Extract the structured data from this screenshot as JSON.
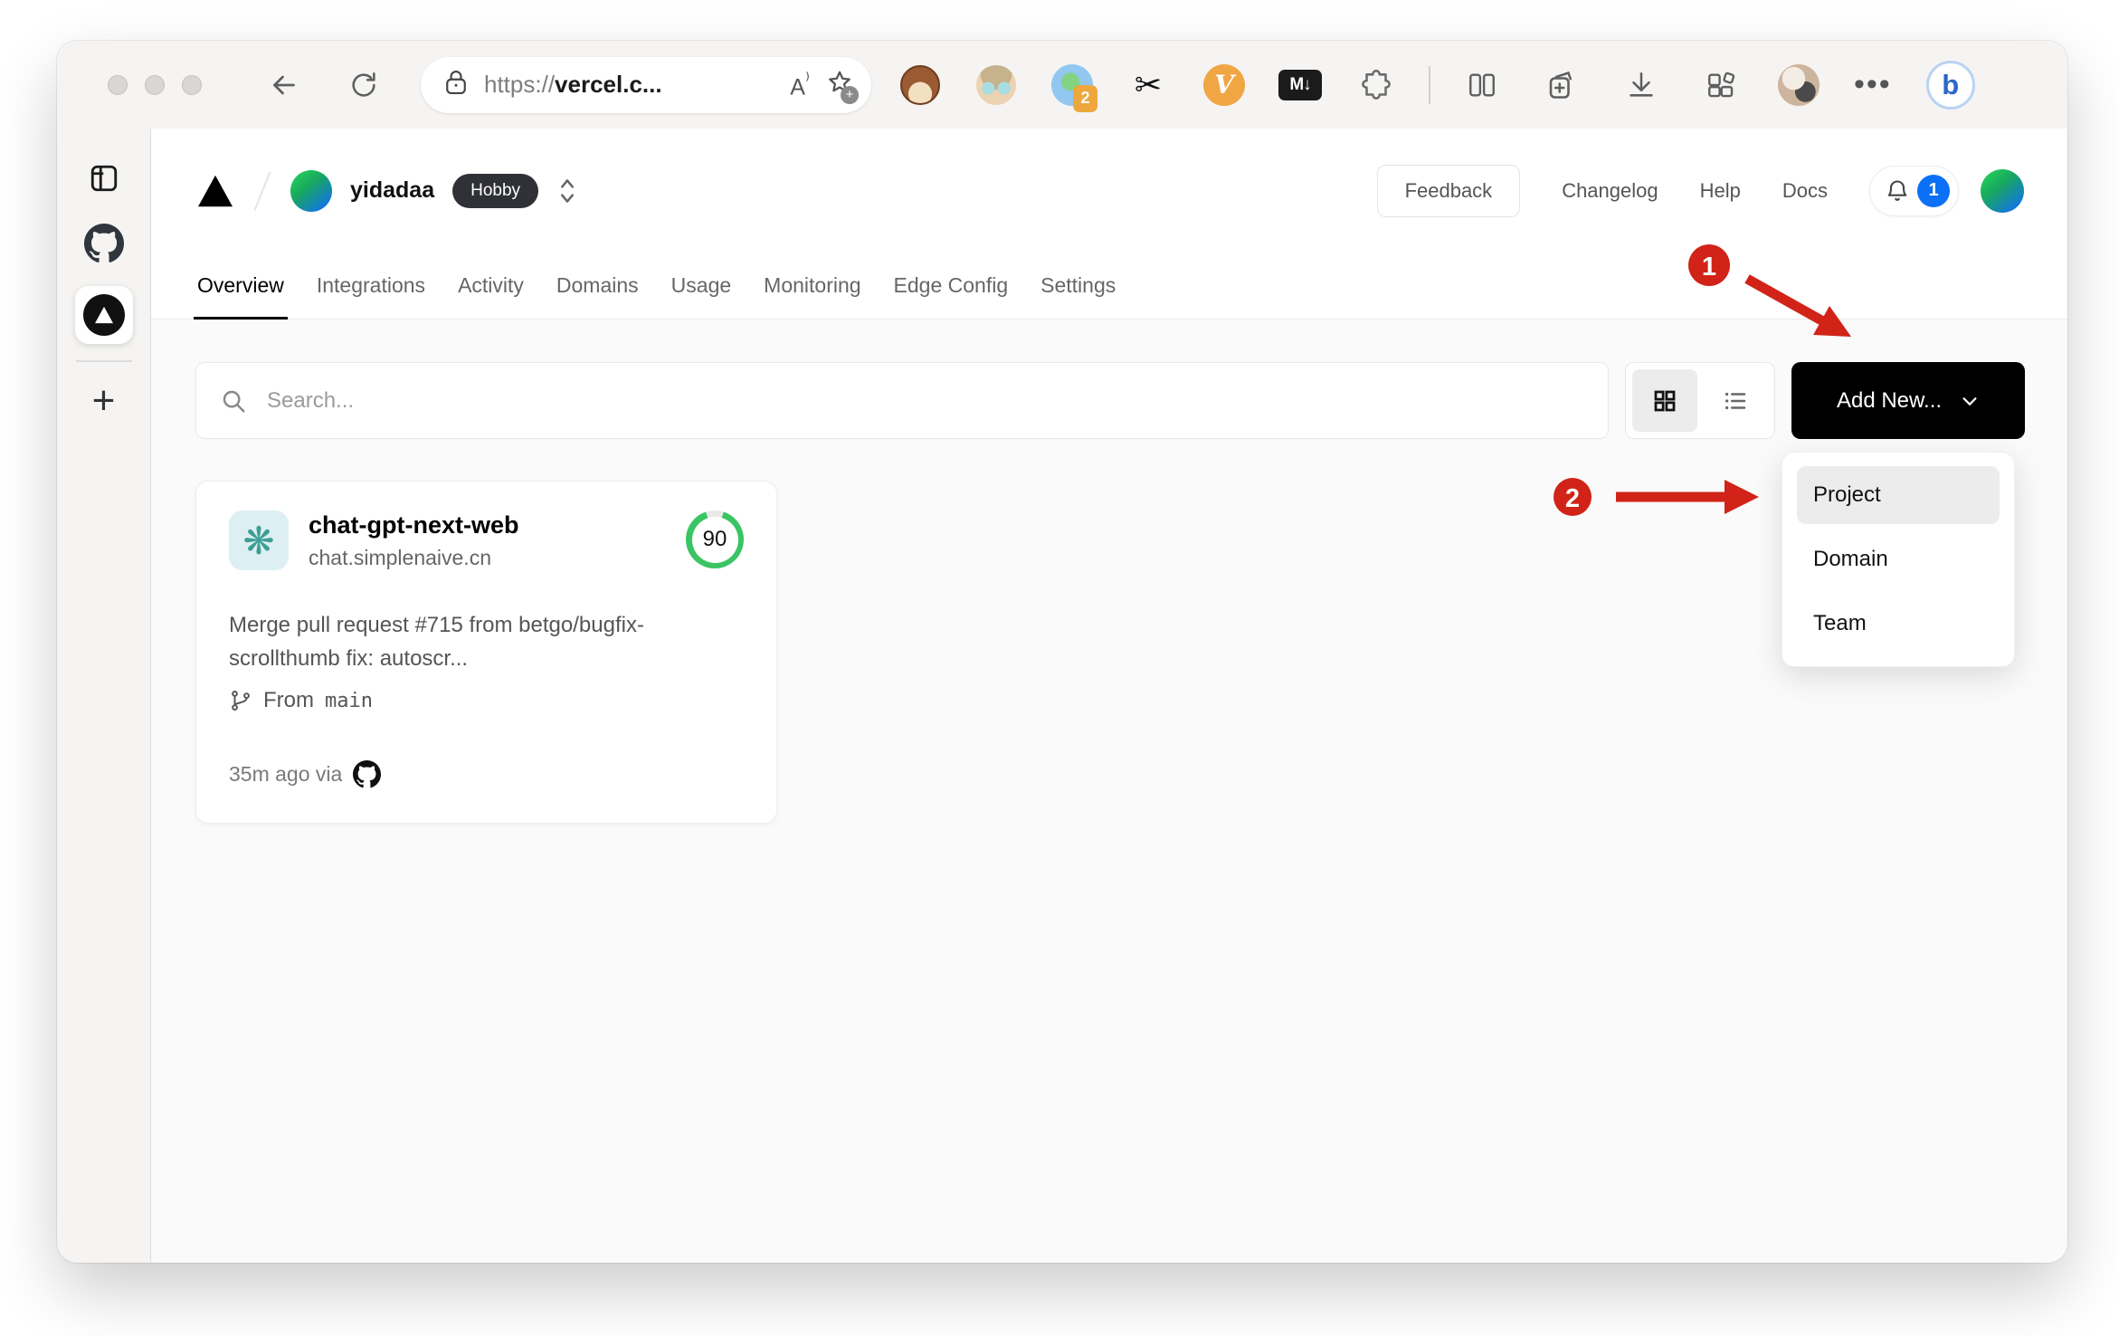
{
  "browser": {
    "url": {
      "scheme": "https://",
      "host_visible": "vercel.c..."
    },
    "extensions": {
      "translate_badge": "2",
      "vimium_label": "V",
      "markdown_label": "M↓",
      "bing_label": "b"
    },
    "sidebar": {
      "new_tab_label": "+"
    }
  },
  "header": {
    "team_name": "yidadaa",
    "plan_badge": "Hobby",
    "feedback_label": "Feedback",
    "links": [
      {
        "label": "Changelog"
      },
      {
        "label": "Help"
      },
      {
        "label": "Docs"
      }
    ],
    "notification_count": "1"
  },
  "tabs": {
    "items": [
      {
        "label": "Overview",
        "active": true
      },
      {
        "label": "Integrations",
        "active": false
      },
      {
        "label": "Activity",
        "active": false
      },
      {
        "label": "Domains",
        "active": false
      },
      {
        "label": "Usage",
        "active": false
      },
      {
        "label": "Monitoring",
        "active": false
      },
      {
        "label": "Edge Config",
        "active": false
      },
      {
        "label": "Settings",
        "active": false
      }
    ]
  },
  "toolbar": {
    "search_placeholder": "Search...",
    "add_new_label": "Add New..."
  },
  "project_card": {
    "name": "chat-gpt-next-web",
    "domain": "chat.simplenaive.cn",
    "score": "90",
    "commit_message": "Merge pull request #715 from betgo/bugfix-scrollthumb fix: autoscr...",
    "branch_prefix": "From",
    "branch_name": "main",
    "deployed_meta": "35m ago via"
  },
  "dropdown": {
    "items": [
      {
        "label": "Project",
        "highlighted": true
      },
      {
        "label": "Domain",
        "highlighted": false
      },
      {
        "label": "Team",
        "highlighted": false
      }
    ]
  },
  "annotations": {
    "step1": "1",
    "step2": "2"
  },
  "colors": {
    "annotation_red": "#d12317",
    "score_green": "#3bc464",
    "notification_blue": "#0b70f5",
    "button_black": "#000000",
    "plan_badge_bg": "#2f3136"
  }
}
